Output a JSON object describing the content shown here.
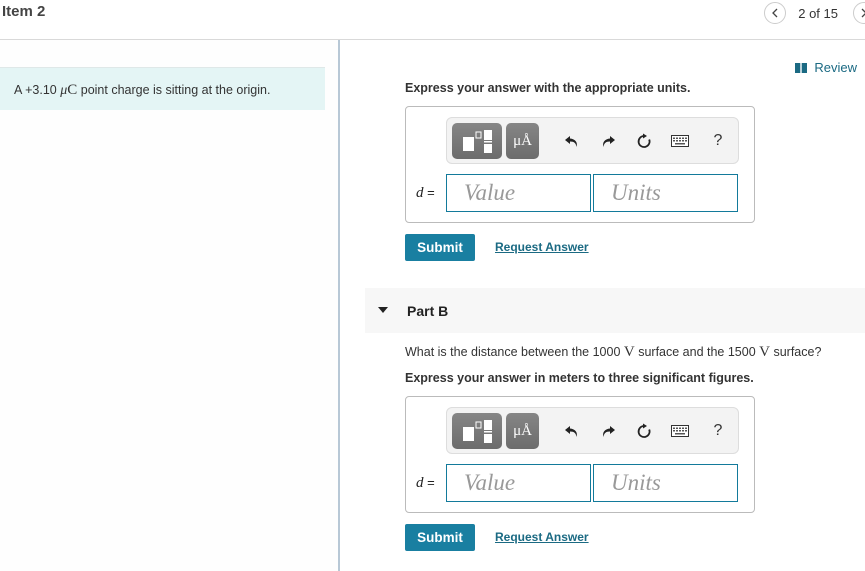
{
  "header": {
    "item_title": "Item 2",
    "pagination": "2 of 15",
    "prev_icon": "chevron-left-icon",
    "next_icon": "chevron-right-icon"
  },
  "review": {
    "label": "Review",
    "icon": "book-icon"
  },
  "problem": {
    "prefix": "A +3.10 ",
    "unit_mu": "μ",
    "unit_c": "C",
    "suffix": " point charge is sitting at the origin."
  },
  "part_a": {
    "instruction": "Express your answer with the appropriate units.",
    "variable": "d",
    "equals": " =",
    "value_placeholder": "Value",
    "units_placeholder": "Units",
    "submit_label": "Submit",
    "request_label": "Request Answer"
  },
  "part_b": {
    "title": "Part B",
    "question_pre": "What is the distance between the 1000 ",
    "question_v1": "V",
    "question_mid": " surface and the 1500 ",
    "question_v2": "V",
    "question_post": " surface?",
    "instruction": "Express your answer in meters to three significant figures.",
    "variable": "d",
    "equals": " =",
    "value_placeholder": "Value",
    "units_placeholder": "Units",
    "submit_label": "Submit",
    "request_label": "Request Answer"
  },
  "toolbar": {
    "units_label": "μÅ",
    "help_label": "?",
    "icons": [
      "templates-icon",
      "units-icon",
      "undo-icon",
      "redo-icon",
      "reset-icon",
      "keyboard-icon",
      "help-icon"
    ]
  },
  "colors": {
    "accent": "#197fa1",
    "link": "#1b6a83",
    "prompt_bg": "#e4f5f5",
    "field_border": "#137a9b"
  }
}
